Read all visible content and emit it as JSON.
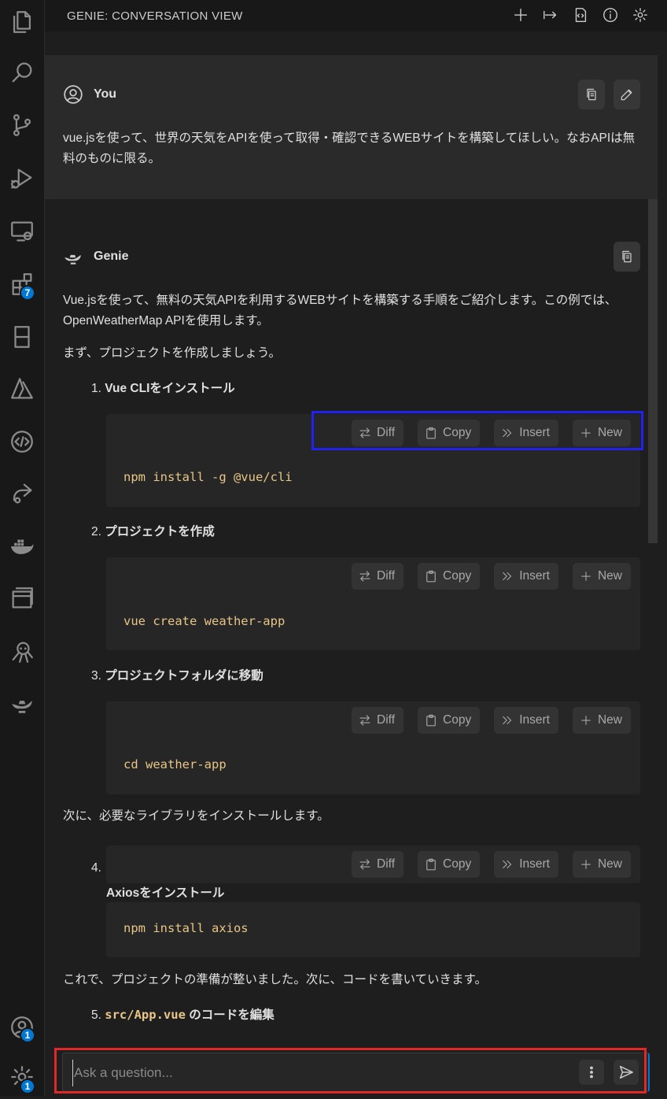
{
  "activity_bar": {
    "items": [
      {
        "icon": "files-icon"
      },
      {
        "icon": "search-icon"
      },
      {
        "icon": "source-control-icon"
      },
      {
        "icon": "run-debug-icon"
      },
      {
        "icon": "remote-explorer-icon"
      },
      {
        "icon": "extensions-icon",
        "badge": "7"
      },
      {
        "icon": "book-icon"
      },
      {
        "icon": "azure-icon"
      },
      {
        "icon": "code-brackets-icon"
      },
      {
        "icon": "live-share-icon"
      },
      {
        "icon": "docker-icon"
      },
      {
        "icon": "windows-icon"
      },
      {
        "icon": "octopus-icon"
      },
      {
        "icon": "genie-lamp-icon"
      }
    ],
    "bottom": [
      {
        "icon": "account-icon",
        "badge": "1"
      },
      {
        "icon": "manage-gear-icon",
        "badge": "1"
      }
    ],
    "badge_color": "#0078d4"
  },
  "header": {
    "title": "GENIE: CONVERSATION VIEW",
    "icons": [
      "plus-icon",
      "arrow-right-to-bar-icon",
      "code-file-icon",
      "info-icon",
      "gear-icon"
    ]
  },
  "user_message": {
    "author": "You",
    "text": "vue.jsを使って、世界の天気をAPIを使って取得・確認できるWEBサイトを構築してほしい。なおAPIは無料のものに限る。"
  },
  "genie_message": {
    "author": "Genie",
    "intro": "Vue.jsを使って、無料の天気APIを利用するWEBサイトを構築する手順をご紹介します。この例では、OpenWeatherMap APIを使用します。",
    "first_step": "まず、プロジェクトを作成しましょう。",
    "steps": [
      {
        "num": "1.",
        "title": "Vue CLIをインストール",
        "code": "npm install -g @vue/cli"
      },
      {
        "num": "2.",
        "title": "プロジェクトを作成",
        "code": "vue create weather-app"
      },
      {
        "num": "3.",
        "title": "プロジェクトフォルダに移動",
        "code": "cd weather-app"
      },
      {
        "num": "4.",
        "title": "Axiosをインストール",
        "code": "npm install axios"
      }
    ],
    "libs_text": "次に、必要なライブラリをインストールします。",
    "ready_text": "これで、プロジェクトの準備が整いました。次に、コードを書いていきます。",
    "step5": {
      "num": "5.",
      "code_part": "src/App.vue",
      "title_part": " のコードを編集"
    }
  },
  "code_buttons": {
    "diff": "Diff",
    "copy": "Copy",
    "insert": "Insert",
    "new": "New"
  },
  "input": {
    "placeholder": "Ask a question..."
  },
  "highlights": {
    "blue": "#2222ee",
    "red": "#e02828"
  }
}
